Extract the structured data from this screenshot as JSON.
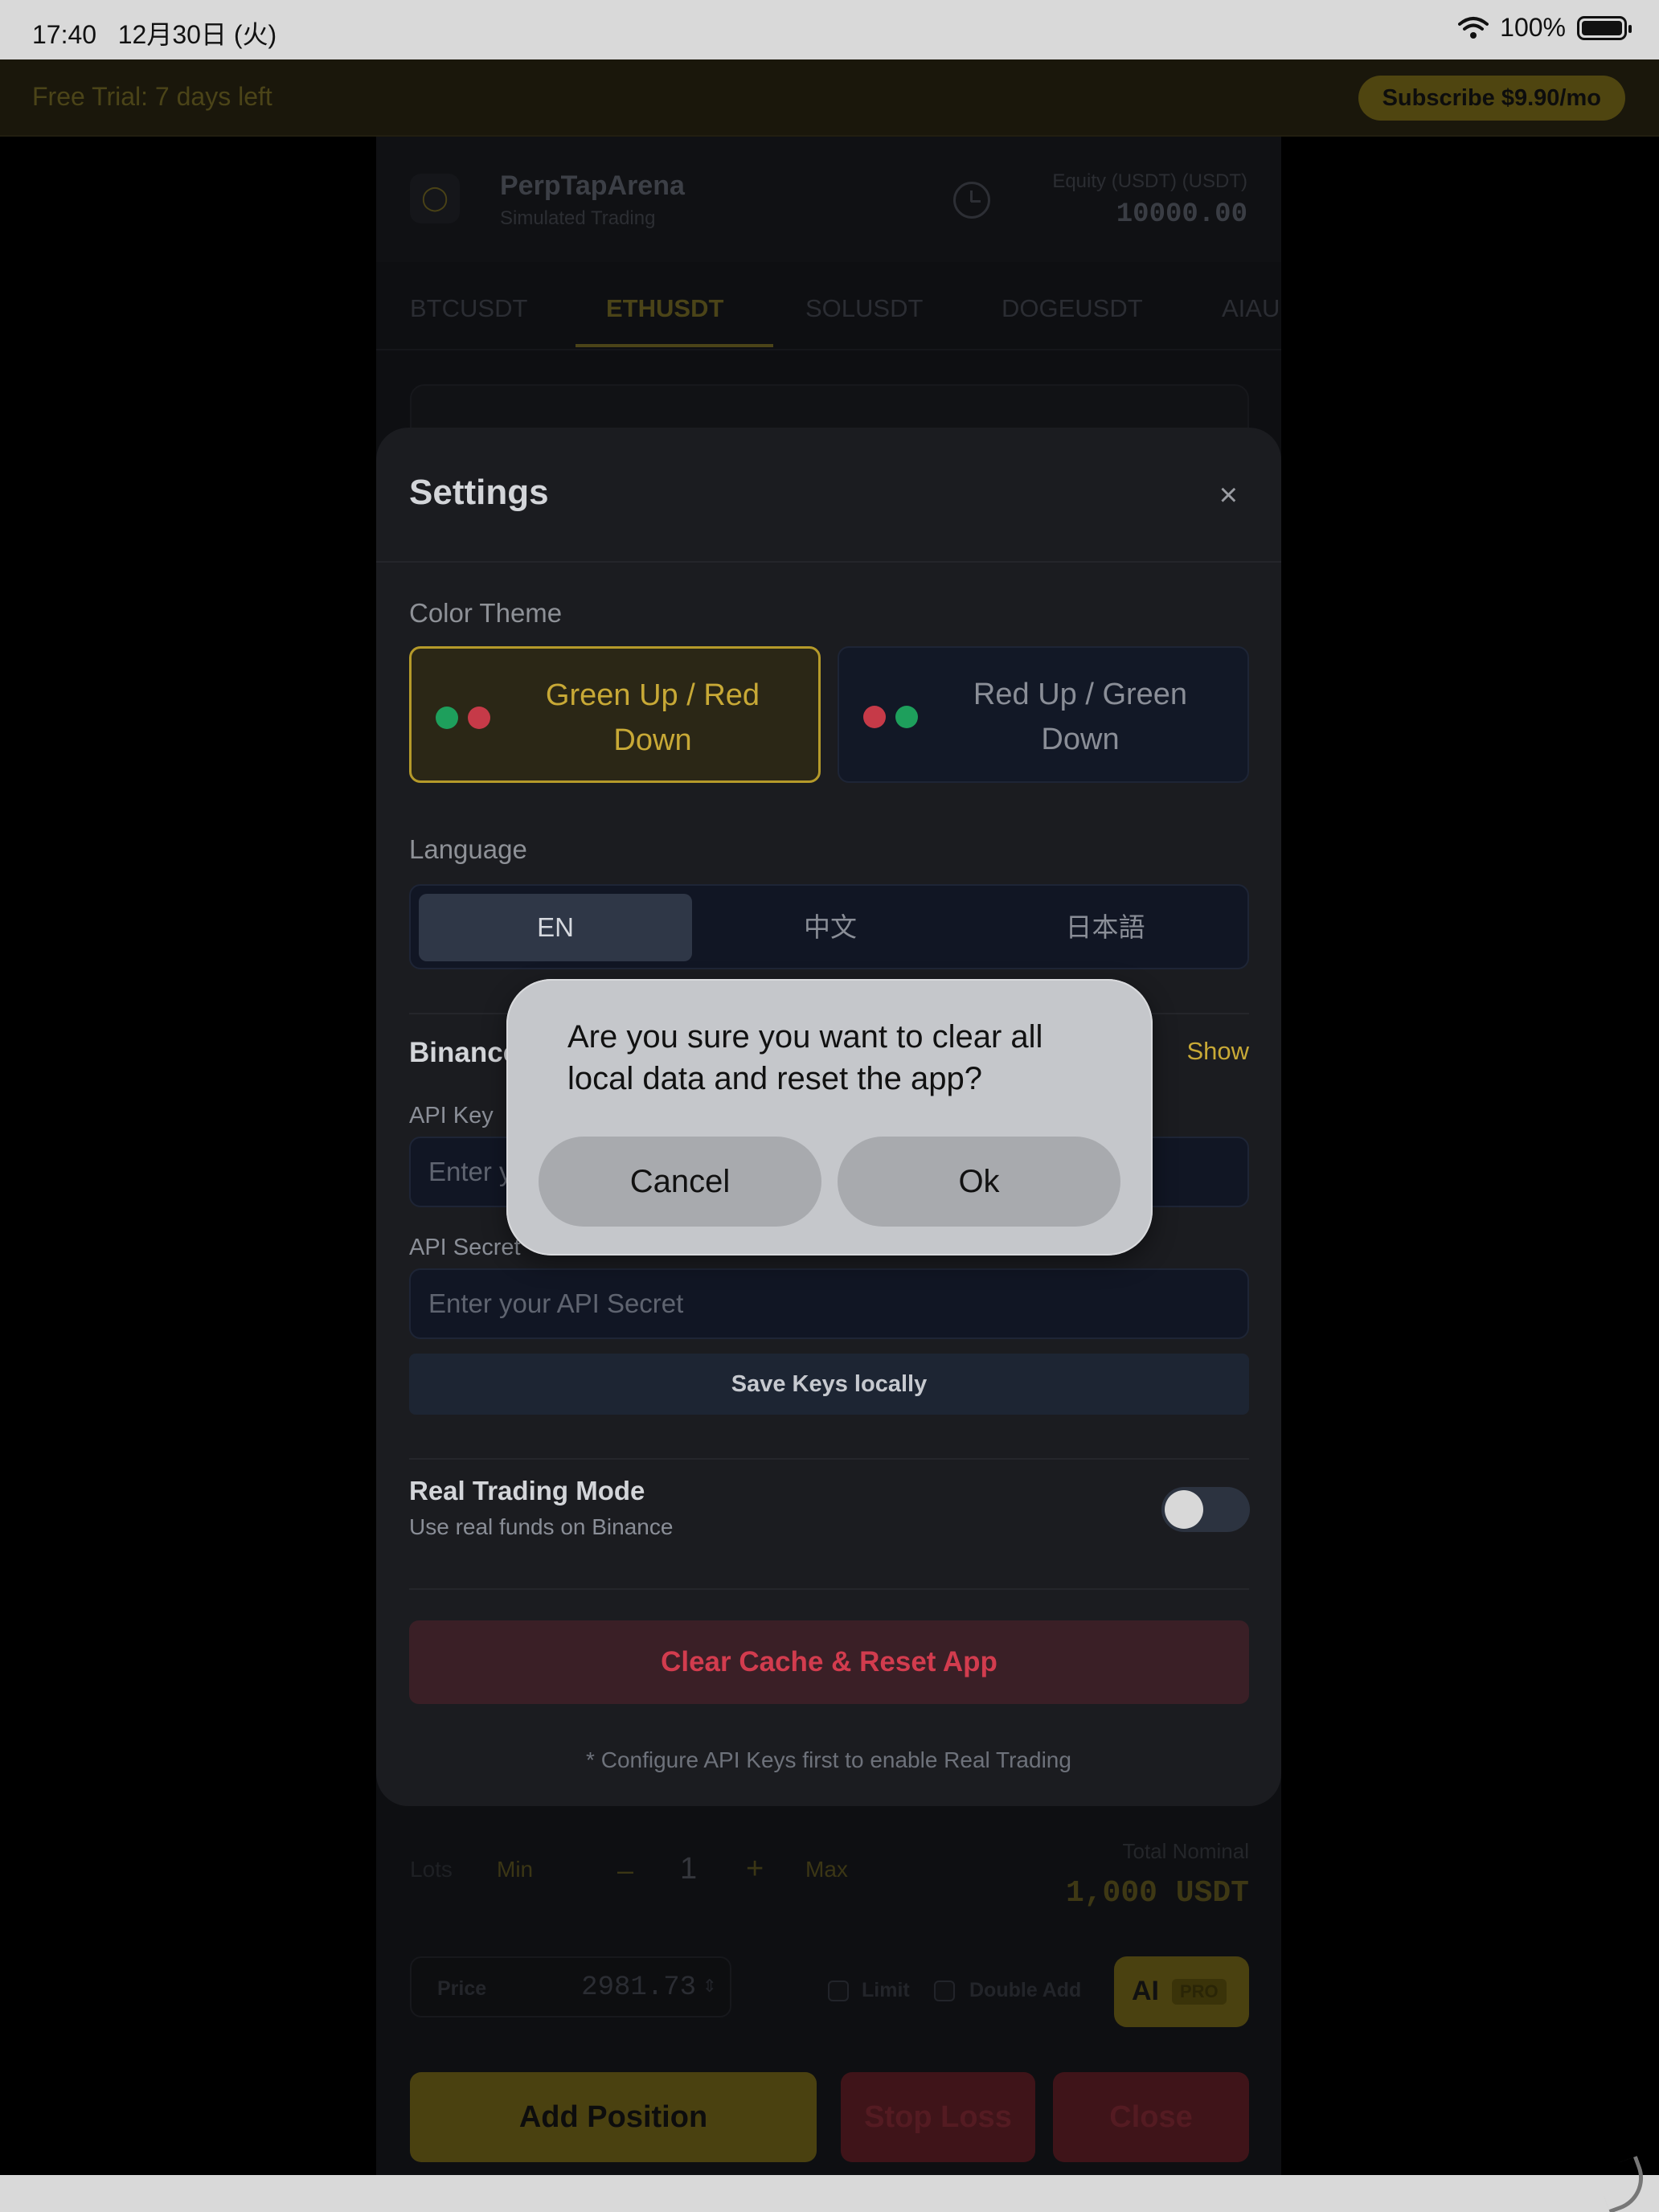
{
  "status_bar": {
    "time": "17:40",
    "date": "12月30日 (火)",
    "battery": "100%"
  },
  "trial_banner": {
    "text": "Free Trial: 7 days left",
    "subscribe_label": "Subscribe $9.90/mo"
  },
  "app": {
    "name": "PerpTapArena",
    "subtitle": "Simulated Trading",
    "equity_label": "Equity (USDT) (USDT)",
    "equity_value": "10000.00",
    "tabs": [
      "BTCUSDT",
      "ETHUSDT",
      "SOLUSDT",
      "DOGEUSDT",
      "AIAU"
    ],
    "active_tab": "ETHUSDT"
  },
  "order_panel": {
    "lots_label": "Lots",
    "min_label": "Min",
    "minus": "–",
    "lots_value": "1",
    "plus": "+",
    "max_label": "Max",
    "total_nominal_label": "Total Nominal",
    "total_nominal_value": "1,000 USDT",
    "price_label": "Price",
    "price_value": "2981.73",
    "limit_label": "Limit",
    "double_add_label": "Double Add",
    "ai_label": "AI",
    "pro_label": "PRO",
    "add_position": "Add Position",
    "stop_loss": "Stop Loss",
    "close": "Close"
  },
  "settings": {
    "title": "Settings",
    "close_symbol": "×",
    "color_theme_label": "Color Theme",
    "theme_options": [
      "Green Up / Red Down",
      "Red Up / Green Down"
    ],
    "selected_theme": "Green Up / Red Down",
    "language_label": "Language",
    "languages": [
      "EN",
      "中文",
      "日本語"
    ],
    "selected_language": "EN",
    "binance_title": "Binance",
    "show_label": "Show",
    "api_key_label": "API Key",
    "api_key_placeholder": "Enter your API Key",
    "api_secret_label": "API Secret",
    "api_secret_placeholder": "Enter your API Secret",
    "save_keys": "Save Keys locally",
    "real_trading_title": "Real Trading Mode",
    "real_trading_sub": "Use real funds on Binance",
    "real_trading_enabled": false,
    "reset_label": "Clear Cache & Reset App",
    "footnote": "* Configure API Keys first to enable Real Trading"
  },
  "alert": {
    "message": "Are you sure you want to clear all local data and reset the app?",
    "cancel": "Cancel",
    "ok": "Ok"
  },
  "colors": {
    "accent": "#c8a936",
    "danger": "#d23c4e",
    "up_green": "#1e9f5c",
    "down_red": "#c63a48"
  }
}
